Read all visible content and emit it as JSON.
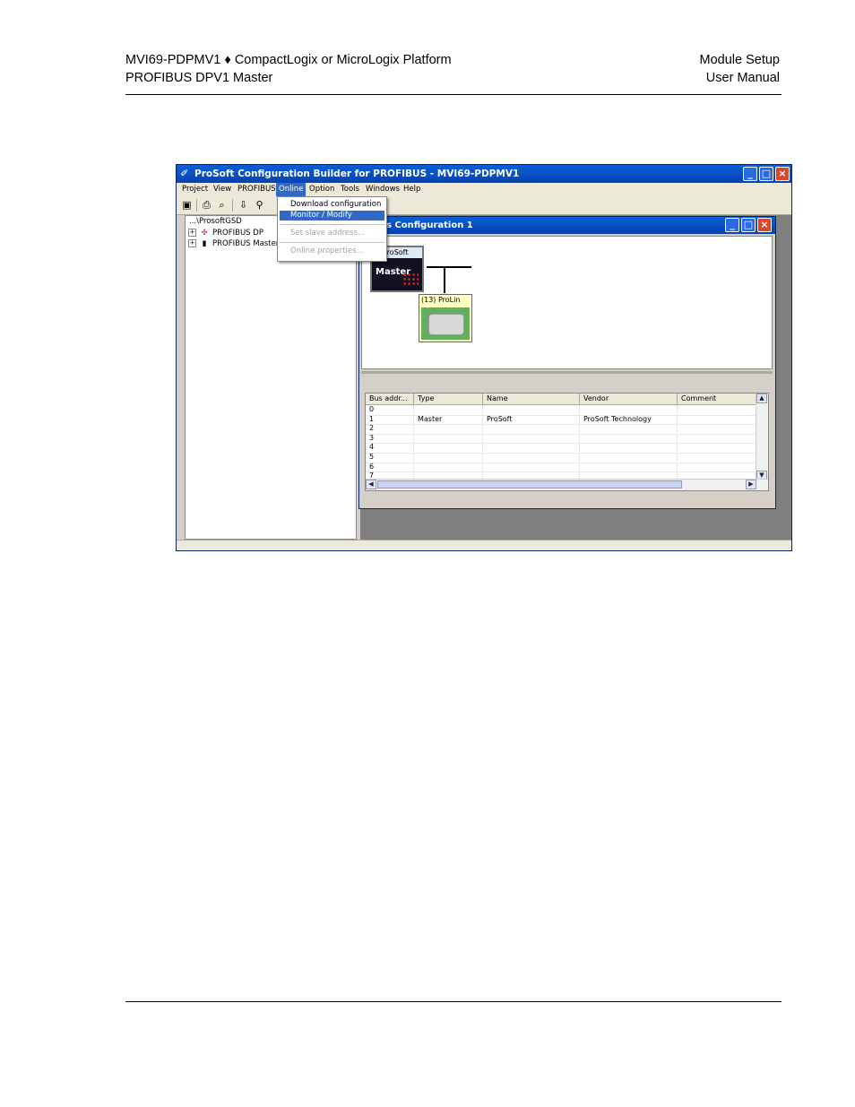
{
  "header": {
    "left_line1": "MVI69-PDPMV1 ♦ CompactLogix or MicroLogix Platform",
    "left_line2": "PROFIBUS DPV1 Master",
    "right_line1": "Module Setup",
    "right_line2": "User Manual"
  },
  "app": {
    "title": "ProSoft Configuration Builder for PROFIBUS - MVI69-PDPMV1",
    "menu": [
      "Project",
      "View",
      "PROFIBUS",
      "Online",
      "Option",
      "Tools",
      "Windows",
      "Help"
    ],
    "active_menu": "Online",
    "online_menu": {
      "items": [
        {
          "label": "Download configuration",
          "state": "normal"
        },
        {
          "label": "Monitor / Modify",
          "state": "selected"
        },
        {
          "label": "Set slave address...",
          "state": "disabled"
        },
        {
          "label": "Online properties...",
          "state": "disabled"
        }
      ]
    },
    "tree": {
      "path": "...\\ProsoftGSD",
      "nodes": [
        "PROFIBUS DP",
        "PROFIBUS Master"
      ]
    },
    "child_window": {
      "title": "s Configuration 1",
      "master_label": "ProSoft",
      "master_text": "Master",
      "slave_label": "(13) ProLin"
    },
    "table": {
      "columns": [
        "Bus addr...",
        "Type",
        "Name",
        "Vendor",
        "Comment"
      ],
      "rows": [
        [
          "0",
          "",
          "",
          "",
          ""
        ],
        [
          "1",
          "Master",
          "ProSoft",
          "ProSoft Technology",
          ""
        ],
        [
          "2",
          "",
          "",
          "",
          ""
        ],
        [
          "3",
          "",
          "",
          "",
          ""
        ],
        [
          "4",
          "",
          "",
          "",
          ""
        ],
        [
          "5",
          "",
          "",
          "",
          ""
        ],
        [
          "6",
          "",
          "",
          "",
          ""
        ],
        [
          "7",
          "",
          "",
          "",
          ""
        ]
      ]
    }
  }
}
